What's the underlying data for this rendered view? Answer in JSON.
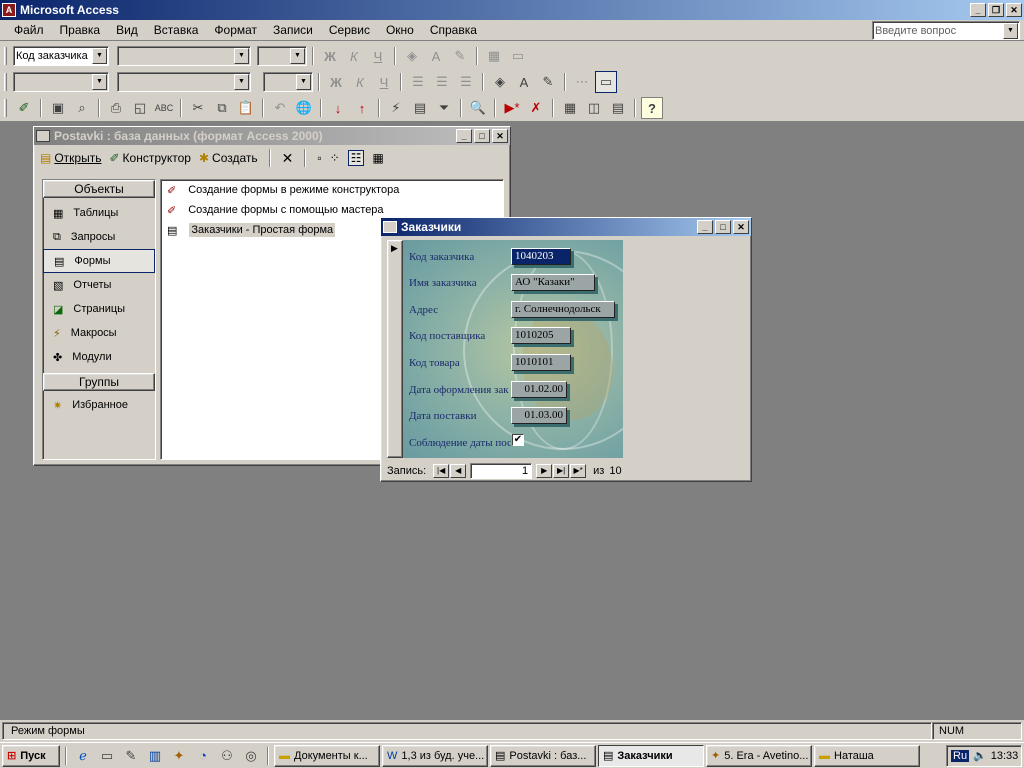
{
  "app": {
    "title": "Microsoft Access",
    "help_placeholder": "Введите вопрос"
  },
  "menu": [
    "Файл",
    "Правка",
    "Вид",
    "Вставка",
    "Формат",
    "Записи",
    "Сервис",
    "Окно",
    "Справка"
  ],
  "toolbar": {
    "object_combo": "Код заказчика"
  },
  "dbwindow": {
    "title": "Postavki : база данных (формат Access 2000)",
    "buttons": {
      "open": "Открыть",
      "design": "Конструктор",
      "create": "Создать"
    },
    "objects_header": "Объекты",
    "groups_header": "Группы",
    "nav": [
      "Таблицы",
      "Запросы",
      "Формы",
      "Отчеты",
      "Страницы",
      "Макросы",
      "Модули"
    ],
    "favorites": "Избранное",
    "items": [
      "Создание формы в режиме конструктора",
      "Создание формы с помощью мастера",
      "Заказчики - Простая форма"
    ]
  },
  "form": {
    "title": "Заказчики",
    "fields": [
      {
        "label": "Код заказчика",
        "value": "1040203"
      },
      {
        "label": "Имя заказчика",
        "value": "АО \"Казаки\""
      },
      {
        "label": "Адрес",
        "value": "г. Солнечнодольск"
      },
      {
        "label": "Код поставщика",
        "value": "1010205"
      },
      {
        "label": "Код товара",
        "value": "1010101"
      },
      {
        "label": "Дата оформления зак",
        "value": "01.02.00"
      },
      {
        "label": "Дата поставки",
        "value": "01.03.00"
      },
      {
        "label": "Соблюдение даты пост",
        "value": "✔"
      }
    ],
    "record_label": "Запись:",
    "record_current": "1",
    "record_of": "из",
    "record_total": "10"
  },
  "status": {
    "mode": "Режим формы",
    "num": "NUM"
  },
  "taskbar": {
    "start": "Пуск",
    "tasks": [
      "Документы к...",
      "1,3 из буд. уче...",
      "Postavki : баз...",
      "Заказчики",
      "5. Era - Avetino...",
      "Наташа"
    ],
    "lang": "Ru",
    "clock": "13:33"
  }
}
